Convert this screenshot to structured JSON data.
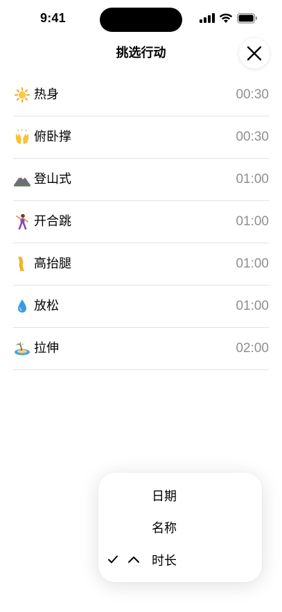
{
  "status": {
    "time": "9:41"
  },
  "header": {
    "title": "挑选行动",
    "close_icon": "close-icon"
  },
  "exercises": [
    {
      "emoji": "sun",
      "name": "热身",
      "duration": "00:30"
    },
    {
      "emoji": "raised-hands",
      "name": "俯卧撑",
      "duration": "00:30"
    },
    {
      "emoji": "mountain",
      "name": "登山式",
      "duration": "01:00"
    },
    {
      "emoji": "dancer",
      "name": "开合跳",
      "duration": "01:00"
    },
    {
      "emoji": "leg",
      "name": "高抬腿",
      "duration": "01:00"
    },
    {
      "emoji": "droplet",
      "name": "放松",
      "duration": "01:00"
    },
    {
      "emoji": "island",
      "name": "拉伸",
      "duration": "02:00"
    }
  ],
  "sort_menu": {
    "options": [
      "日期",
      "名称",
      "时长"
    ],
    "selected": "时长",
    "direction": "ascending"
  },
  "colors": {
    "secondary_text": "#8e8e93",
    "divider": "#e2e2e2"
  }
}
